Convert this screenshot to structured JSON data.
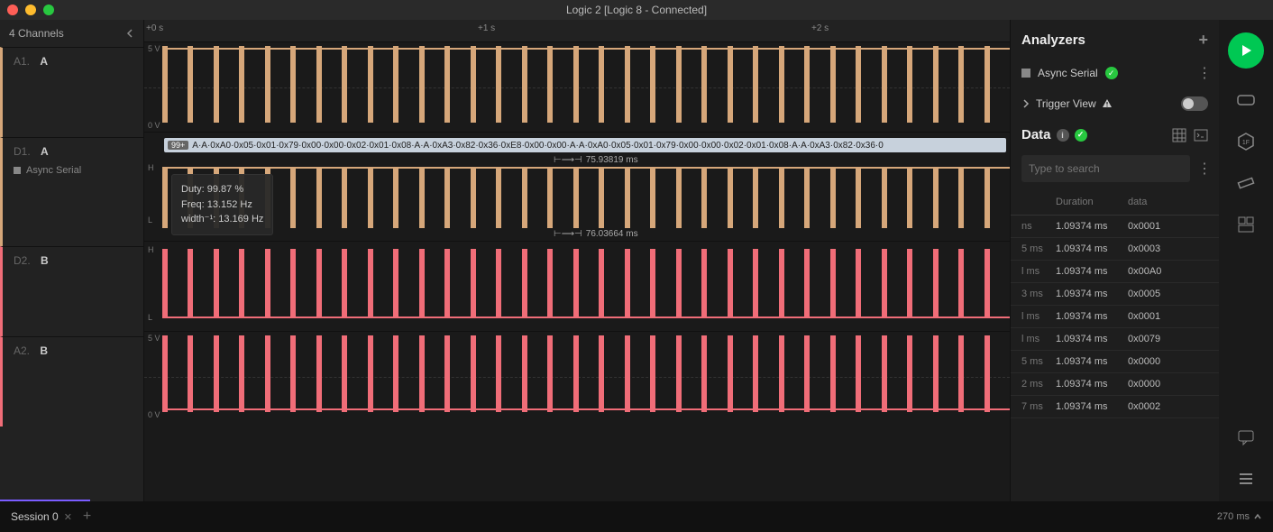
{
  "window": {
    "title": "Logic 2 [Logic 8 - Connected]"
  },
  "left": {
    "header": "4 Channels",
    "channels": [
      {
        "idx": "A1.",
        "name": "A",
        "sub": null
      },
      {
        "idx": "D1.",
        "name": "A",
        "sub": "Async Serial"
      },
      {
        "idx": "D2.",
        "name": "B",
        "sub": null
      },
      {
        "idx": "A2.",
        "name": "B",
        "sub": null
      }
    ]
  },
  "timeline": {
    "t0": "+0 s",
    "t1": "+1 s",
    "t2": "+2 s",
    "a1_top": "5 V",
    "a1_bot": "0 V",
    "a2_top": "5 V",
    "a2_bot": "0 V",
    "d1_h": "H",
    "d1_l": "L",
    "d2_h": "H",
    "d2_l": "L",
    "decode_badge": "99+",
    "decode_text": "A·A·0xA0·0x05·0x01·0x79·0x00·0x00·0x02·0x01·0x08·A·A·0xA3·0x82·0x36·0xE8·0x00·0x00·A·A·0xA0·0x05·0x01·0x79·0x00·0x00·0x02·0x01·0x08·A·A·0xA3·0x82·0x36·0",
    "meas1": "75.93819 ms",
    "meas2": "76.03664 ms",
    "tooltip": {
      "duty": "Duty: 99.87 %",
      "freq": "Freq: 13.152 Hz",
      "width": "width⁻¹: 13.169 Hz"
    }
  },
  "analyzers": {
    "title": "Analyzers",
    "item": "Async Serial",
    "trigger": "Trigger View"
  },
  "data": {
    "title": "Data",
    "search_placeholder": "Type to search",
    "cols": {
      "a": "",
      "b": "Duration",
      "c": "data"
    },
    "rows": [
      {
        "a": "ns",
        "b": "1.09374 ms",
        "c": "0x0001"
      },
      {
        "a": "5 ms",
        "b": "1.09374 ms",
        "c": "0x0003"
      },
      {
        "a": "l ms",
        "b": "1.09374 ms",
        "c": "0x00A0"
      },
      {
        "a": "3 ms",
        "b": "1.09374 ms",
        "c": "0x0005"
      },
      {
        "a": "l ms",
        "b": "1.09374 ms",
        "c": "0x0001"
      },
      {
        "a": "l ms",
        "b": "1.09374 ms",
        "c": "0x0079"
      },
      {
        "a": "5 ms",
        "b": "1.09374 ms",
        "c": "0x0000"
      },
      {
        "a": "2 ms",
        "b": "1.09374 ms",
        "c": "0x0000"
      },
      {
        "a": "7 ms",
        "b": "1.09374 ms",
        "c": "0x0002"
      }
    ]
  },
  "bottom": {
    "session": "Session 0",
    "zoom": "270 ms"
  }
}
